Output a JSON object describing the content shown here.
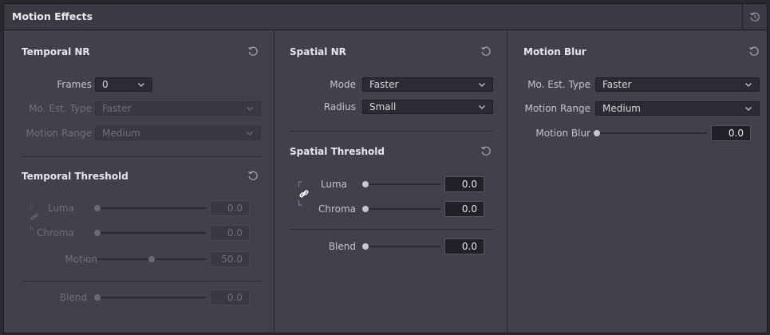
{
  "panel": {
    "title": "Motion Effects"
  },
  "temporal_nr": {
    "title": "Temporal NR",
    "frames": {
      "label": "Frames",
      "value": "0"
    },
    "mo_est_type": {
      "label": "Mo. Est. Type",
      "value": "Faster"
    },
    "motion_range": {
      "label": "Motion Range",
      "value": "Medium"
    }
  },
  "temporal_threshold": {
    "title": "Temporal Threshold",
    "luma": {
      "label": "Luma",
      "value": "0.0",
      "level": 0
    },
    "chroma": {
      "label": "Chroma",
      "value": "0.0",
      "level": 0
    },
    "motion": {
      "label": "Motion",
      "value": "50.0",
      "level": 0.5
    },
    "blend": {
      "label": "Blend",
      "value": "0.0",
      "level": 0
    }
  },
  "spatial_nr": {
    "title": "Spatial NR",
    "mode": {
      "label": "Mode",
      "value": "Faster"
    },
    "radius": {
      "label": "Radius",
      "value": "Small"
    }
  },
  "spatial_threshold": {
    "title": "Spatial Threshold",
    "luma": {
      "label": "Luma",
      "value": "0.0",
      "level": 0
    },
    "chroma": {
      "label": "Chroma",
      "value": "0.0",
      "level": 0
    },
    "blend": {
      "label": "Blend",
      "value": "0.0",
      "level": 0
    }
  },
  "motion_blur": {
    "title": "Motion Blur",
    "mo_est_type": {
      "label": "Mo. Est. Type",
      "value": "Faster"
    },
    "motion_range": {
      "label": "Motion Range",
      "value": "Medium"
    },
    "motion_blur": {
      "label": "Motion Blur",
      "value": "0.0",
      "level": 0
    }
  },
  "icons": {
    "reset": "reset-icon",
    "chevron": "chevron-down-icon",
    "link": "link-icon"
  },
  "colors": {
    "panel_bg": "#40414b",
    "header_bg": "#3a3b42",
    "field_bg": "#2b2c33",
    "text": "#c8c8cc",
    "disabled_text": "#6e6f78"
  }
}
